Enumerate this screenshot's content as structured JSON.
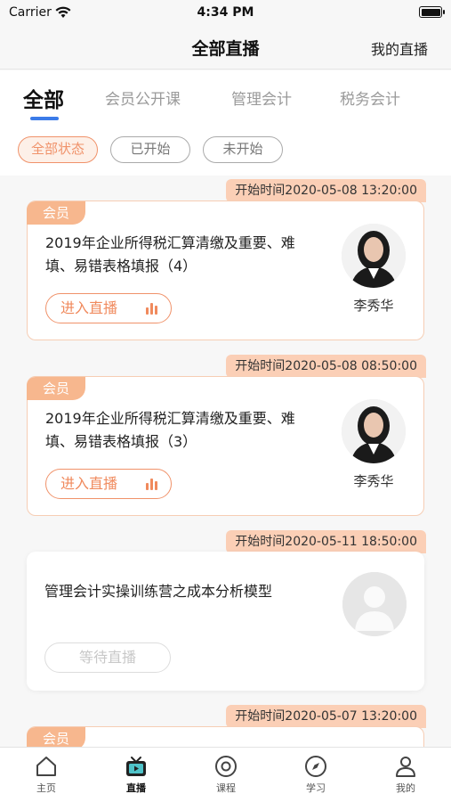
{
  "status_bar": {
    "carrier": "Carrier",
    "time": "4:34 PM"
  },
  "nav": {
    "title": "全部直播",
    "right_action": "我的直播"
  },
  "tabs": [
    {
      "label": "全部",
      "active": true
    },
    {
      "label": "会员公开课",
      "active": false
    },
    {
      "label": "管理会计",
      "active": false
    },
    {
      "label": "税务会计",
      "active": false
    }
  ],
  "filters": [
    {
      "label": "全部状态",
      "active": true
    },
    {
      "label": "已开始",
      "active": false
    },
    {
      "label": "未开始",
      "active": false
    }
  ],
  "cards": [
    {
      "start_time": "开始时间2020-05-08 13:20:00",
      "badge": "会员",
      "title": "2019年企业所得税汇算清缴及重要、难填、易错表格填报（4）",
      "action": "进入直播",
      "teacher": "李秀华"
    },
    {
      "start_time": "开始时间2020-05-08 08:50:00",
      "badge": "会员",
      "title": "2019年企业所得税汇算清缴及重要、难填、易错表格填报（3）",
      "action": "进入直播",
      "teacher": "李秀华"
    },
    {
      "start_time": "开始时间2020-05-11 18:50:00",
      "title": "管理会计实操训练营之成本分析模型",
      "action": "等待直播"
    },
    {
      "start_time": "开始时间2020-05-07 13:20:00",
      "badge": "会员"
    }
  ],
  "tab_bar": [
    {
      "label": "主页",
      "icon": "home-icon"
    },
    {
      "label": "直播",
      "icon": "tv-icon",
      "active": true
    },
    {
      "label": "课程",
      "icon": "target-icon"
    },
    {
      "label": "学习",
      "icon": "compass-icon"
    },
    {
      "label": "我的",
      "icon": "user-icon"
    }
  ],
  "colors": {
    "accent": "#f08a5d",
    "tab_indicator": "#3b7be8",
    "time_tag_bg": "#fbcfb6"
  }
}
